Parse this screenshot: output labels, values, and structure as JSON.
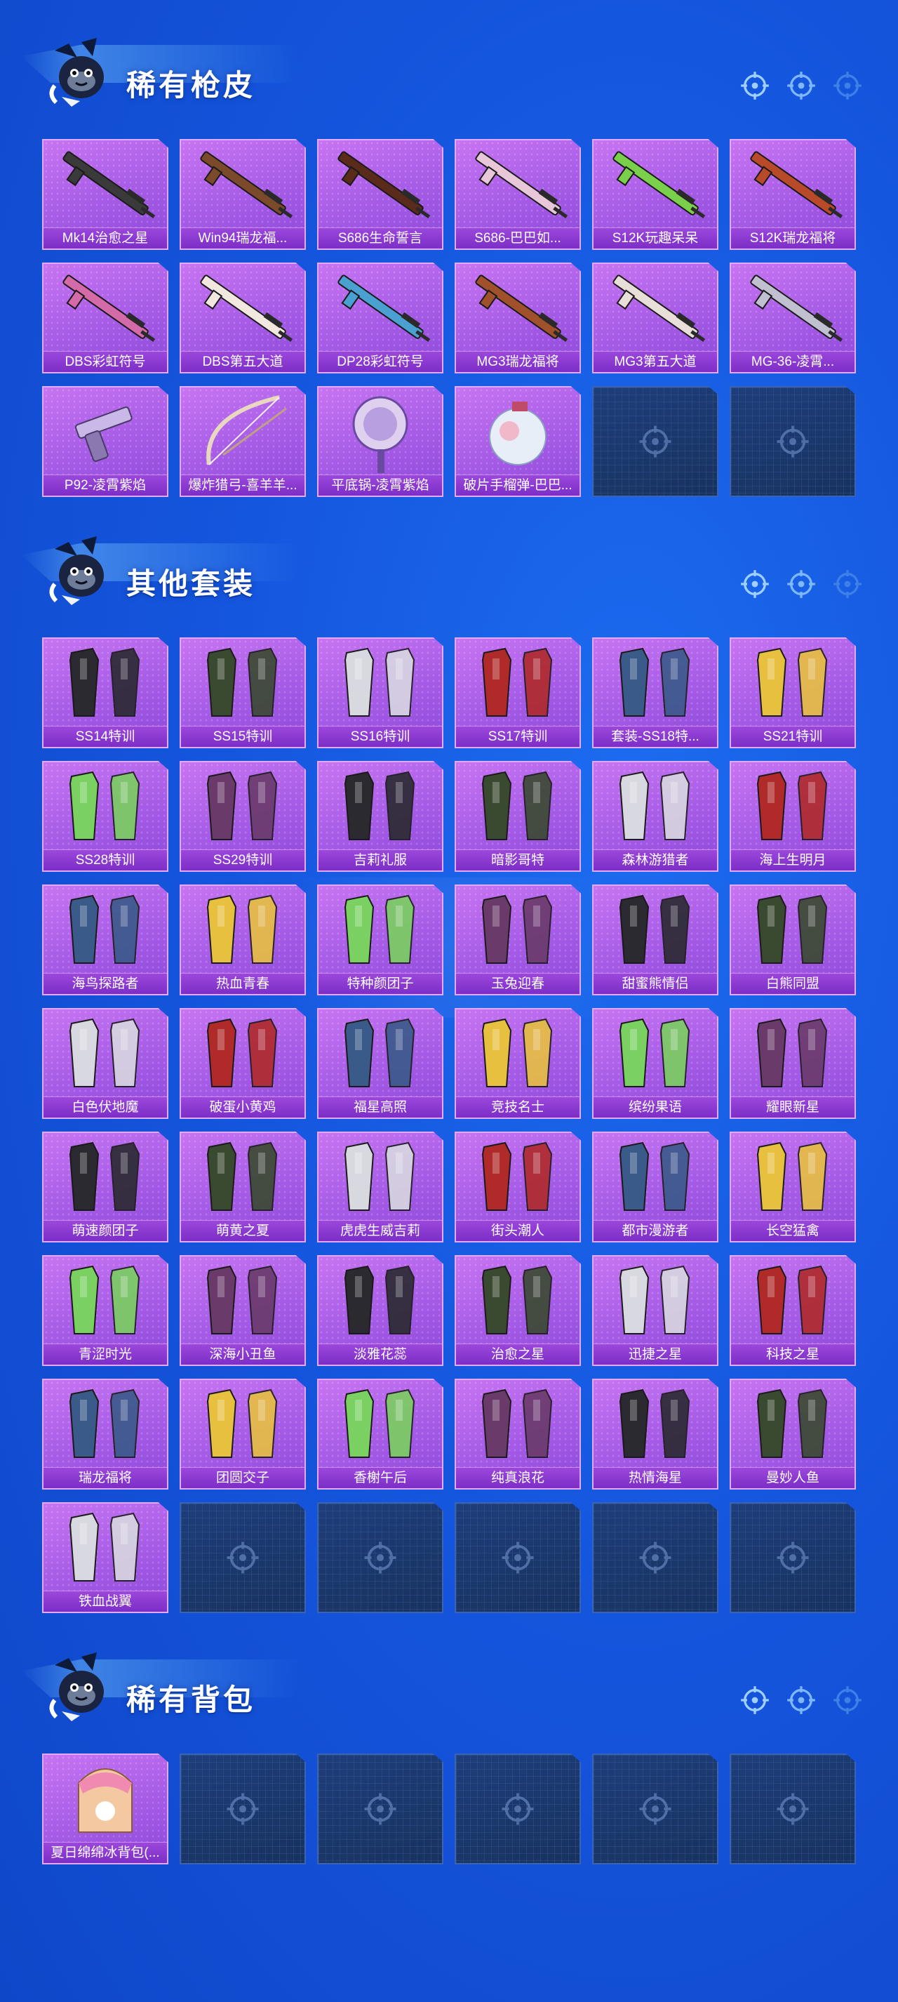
{
  "colors": {
    "background": "#1556de",
    "card_purple": "#a55be6",
    "card_label": "#7c2ec6",
    "empty_slot": "#1e3e7a"
  },
  "icons": {
    "header_decor": [
      "crosshair-icon",
      "crosshair-icon",
      "crosshair-icon"
    ],
    "empty_slot": "crosshair-icon",
    "mascot": "mascot-icon"
  },
  "sections": [
    {
      "title": "稀有枪皮",
      "items": [
        {
          "label": "Mk14治愈之星",
          "kind": "rifle"
        },
        {
          "label": "Win94瑞龙福...",
          "kind": "rifle"
        },
        {
          "label": "S686生命誓言",
          "kind": "rifle"
        },
        {
          "label": "S686-巴巴如...",
          "kind": "rifle"
        },
        {
          "label": "S12K玩趣呆呆",
          "kind": "rifle"
        },
        {
          "label": "S12K瑞龙福将",
          "kind": "rifle"
        },
        {
          "label": "DBS彩虹符号",
          "kind": "rifle"
        },
        {
          "label": "DBS第五大道",
          "kind": "rifle"
        },
        {
          "label": "DP28彩虹符号",
          "kind": "rifle"
        },
        {
          "label": "MG3瑞龙福将",
          "kind": "rifle"
        },
        {
          "label": "MG3第五大道",
          "kind": "rifle"
        },
        {
          "label": "MG-36-凌霄...",
          "kind": "rifle"
        },
        {
          "label": "P92-凌霄紫焰",
          "kind": "pistol"
        },
        {
          "label": "爆炸猎弓-喜羊羊...",
          "kind": "bow"
        },
        {
          "label": "平底锅-凌霄紫焰",
          "kind": "pan"
        },
        {
          "label": "破片手榴弹-巴巴...",
          "kind": "grenade"
        }
      ],
      "empty_slots": 2
    },
    {
      "title": "其他套装",
      "items": [
        {
          "label": "SS14特训",
          "kind": "outfit"
        },
        {
          "label": "SS15特训",
          "kind": "outfit"
        },
        {
          "label": "SS16特训",
          "kind": "outfit"
        },
        {
          "label": "SS17特训",
          "kind": "outfit"
        },
        {
          "label": "套装-SS18特...",
          "kind": "outfit"
        },
        {
          "label": "SS21特训",
          "kind": "outfit"
        },
        {
          "label": "SS28特训",
          "kind": "outfit"
        },
        {
          "label": "SS29特训",
          "kind": "outfit"
        },
        {
          "label": "吉莉礼服",
          "kind": "outfit"
        },
        {
          "label": "暗影哥特",
          "kind": "outfit"
        },
        {
          "label": "森林游猎者",
          "kind": "outfit"
        },
        {
          "label": "海上生明月",
          "kind": "outfit"
        },
        {
          "label": "海鸟探路者",
          "kind": "outfit"
        },
        {
          "label": "热血青春",
          "kind": "outfit"
        },
        {
          "label": "特种颜团子",
          "kind": "outfit"
        },
        {
          "label": "玉兔迎春",
          "kind": "outfit"
        },
        {
          "label": "甜蜜熊情侣",
          "kind": "outfit"
        },
        {
          "label": "白熊同盟",
          "kind": "outfit"
        },
        {
          "label": "白色伏地魔",
          "kind": "outfit"
        },
        {
          "label": "破蛋小黄鸡",
          "kind": "outfit"
        },
        {
          "label": "福星高照",
          "kind": "outfit"
        },
        {
          "label": "竞技名士",
          "kind": "outfit"
        },
        {
          "label": "缤纷果语",
          "kind": "outfit"
        },
        {
          "label": "耀眼新星",
          "kind": "outfit"
        },
        {
          "label": "萌速颜团子",
          "kind": "outfit"
        },
        {
          "label": "萌黄之夏",
          "kind": "outfit"
        },
        {
          "label": "虎虎生威吉莉",
          "kind": "outfit"
        },
        {
          "label": "街头潮人",
          "kind": "outfit"
        },
        {
          "label": "都市漫游者",
          "kind": "outfit"
        },
        {
          "label": "长空猛禽",
          "kind": "outfit"
        },
        {
          "label": "青涩时光",
          "kind": "outfit"
        },
        {
          "label": "深海小丑鱼",
          "kind": "outfit"
        },
        {
          "label": "淡雅花蕊",
          "kind": "outfit"
        },
        {
          "label": "治愈之星",
          "kind": "outfit"
        },
        {
          "label": "迅捷之星",
          "kind": "outfit"
        },
        {
          "label": "科技之星",
          "kind": "outfit"
        },
        {
          "label": "瑞龙福将",
          "kind": "outfit"
        },
        {
          "label": "团圆交子",
          "kind": "outfit"
        },
        {
          "label": "香榭午后",
          "kind": "outfit"
        },
        {
          "label": "纯真浪花",
          "kind": "outfit"
        },
        {
          "label": "热情海星",
          "kind": "outfit"
        },
        {
          "label": "曼妙人鱼",
          "kind": "outfit"
        },
        {
          "label": "铁血战翼",
          "kind": "outfit"
        }
      ],
      "empty_slots": 5
    },
    {
      "title": "稀有背包",
      "items": [
        {
          "label": "夏日绵绵冰背包(...",
          "kind": "backpack"
        }
      ],
      "empty_slots": 5
    }
  ]
}
